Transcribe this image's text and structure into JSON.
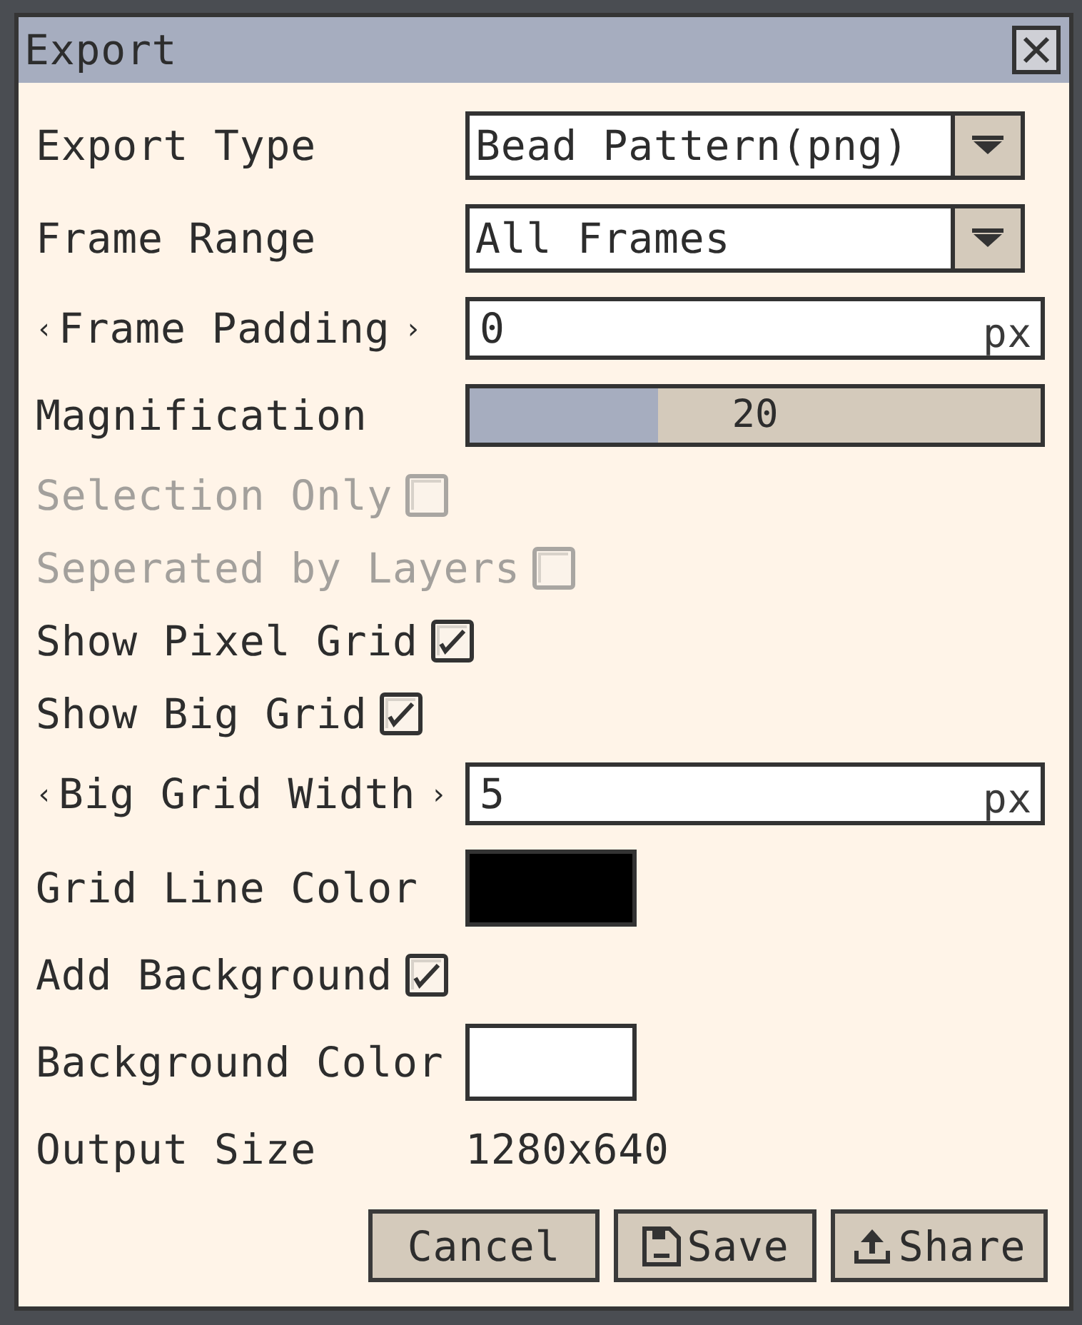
{
  "window": {
    "title": "Export"
  },
  "fields": [
    {
      "kind": "dropdown",
      "label": "Export Type",
      "value": "Bead Pattern(png)",
      "disabled": false
    },
    {
      "kind": "dropdown",
      "label": "Frame Range",
      "value": "All Frames",
      "disabled": false
    },
    {
      "kind": "number",
      "label": "Frame Padding",
      "arrow_left": "‹",
      "arrow_right": "›",
      "value": "0",
      "unit": "px",
      "disabled": false
    },
    {
      "kind": "slider",
      "label": "Magnification",
      "level": 0.33,
      "reading": "20",
      "disabled": false
    },
    {
      "kind": "checkbox",
      "label": "Selection Only",
      "checked": false,
      "disabled": true
    },
    {
      "kind": "checkbox",
      "label": "Seperated by Layers",
      "checked": false,
      "disabled": true
    },
    {
      "kind": "checkbox",
      "label": "Show Pixel Grid",
      "checked": true,
      "disabled": false
    },
    {
      "kind": "checkbox",
      "label": "Show Big Grid",
      "checked": true,
      "disabled": false
    },
    {
      "kind": "number",
      "label": "Big Grid Width",
      "arrow_left": "‹",
      "arrow_right": "›",
      "value": "5",
      "unit": "px",
      "disabled": false
    },
    {
      "kind": "color",
      "label": "Grid Line Color",
      "color": "#000000",
      "disabled": false
    },
    {
      "kind": "checkbox",
      "label": "Add Background",
      "checked": true,
      "disabled": false
    },
    {
      "kind": "color",
      "label": "Background Color",
      "color": "#ffffff",
      "disabled": false
    },
    {
      "kind": "text",
      "label": "Output Size",
      "value": "1280x640",
      "disabled": false
    }
  ],
  "buttons": [
    {
      "kind": "cancel",
      "label": "Cancel"
    },
    {
      "kind": "save",
      "label": "Save"
    },
    {
      "kind": "share",
      "label": "Share"
    }
  ]
}
